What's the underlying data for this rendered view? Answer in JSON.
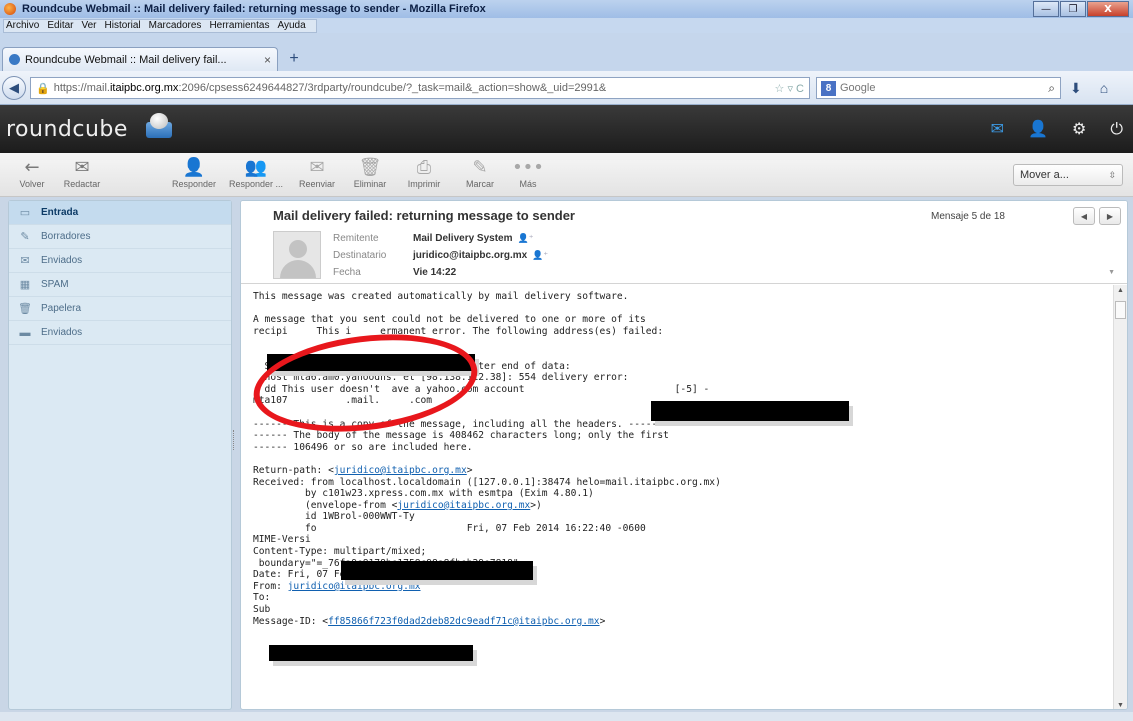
{
  "window": {
    "title": "Roundcube Webmail :: Mail delivery failed: returning message to sender - Mozilla Firefox",
    "minimize": "—",
    "maximize": "❐",
    "close": "X"
  },
  "menubar": {
    "items": [
      "Archivo",
      "Editar",
      "Ver",
      "Historial",
      "Marcadores",
      "Herramientas",
      "Ayuda"
    ]
  },
  "tab": {
    "label": "Roundcube Webmail :: Mail delivery fail...",
    "close": "×",
    "new_tab": "+"
  },
  "navbar": {
    "url_prefix": "https://mail.",
    "url_domain": "itaipbc.org.mx",
    "url_rest": ":2096/cpsess6249644827/3rdparty/roundcube/?_task=mail&_action=show&_uid=2991&",
    "search_placeholder": "Google",
    "search_engine_letter": "8"
  },
  "app": {
    "logo": "roundcube",
    "icons": [
      "mail-icon",
      "user-icon",
      "gear-icon",
      "power-icon"
    ]
  },
  "toolbar": {
    "buttons": [
      {
        "label": "Volver",
        "icon": "←"
      },
      {
        "label": "Redactar",
        "icon": "✉"
      },
      {
        "label": "Responder",
        "icon": "👤"
      },
      {
        "label": "Responder ...",
        "icon": "👥"
      },
      {
        "label": "Reenviar",
        "icon": "✉"
      },
      {
        "label": "Eliminar",
        "icon": "🗑"
      },
      {
        "label": "Imprimir",
        "icon": "⎙"
      },
      {
        "label": "Marcar",
        "icon": "✎"
      },
      {
        "label": "Más",
        "icon": "•••"
      }
    ],
    "move_select": "Mover a..."
  },
  "folders": [
    {
      "label": "Entrada",
      "icon": "▭",
      "selected": true
    },
    {
      "label": "Borradores",
      "icon": "✎",
      "selected": false
    },
    {
      "label": "Enviados",
      "icon": "✉",
      "selected": false
    },
    {
      "label": "SPAM",
      "icon": "▦",
      "selected": false
    },
    {
      "label": "Papelera",
      "icon": "🗑",
      "selected": false
    },
    {
      "label": "Enviados",
      "icon": "▬",
      "selected": false
    }
  ],
  "message": {
    "subject": "Mail delivery failed: returning message to sender",
    "counter": "Mensaje 5 de 18",
    "prev": "◀",
    "next": "▶",
    "headers": {
      "from_label": "Remitente",
      "from_value": "Mail Delivery System",
      "to_label": "Destinatario",
      "to_value": "juridico@itaipbc.org.mx",
      "date_label": "Fecha",
      "date_value": "Vie 14:22"
    },
    "lines": [
      "This message was created automatically by mail delivery software.",
      "",
      "A message that you sent could not be delivered to one or more of its",
      "recipi     This i     ermanent error. The following address(es) failed:",
      "",
      "",
      "  SMTP error from remote m il server after end of data:",
      "  host mta6.am0.yahoodns. et [98.138.112.38]: 554 delivery error:",
      "  dd This user doesn't  ave a yahoo.com account                          [-5] -",
      "mta107          .mail.     .com",
      "",
      "------ This is a copy of the message, including all the headers. ------",
      "------ The body of the message is 408462 characters long; only the first",
      "------ 106496 or so are included here.",
      "",
      "Return-path: <juridico@itaipbc.org.mx>",
      "Received: from localhost.localdomain ([127.0.0.1]:38474 helo=mail.itaipbc.org.mx)",
      "         by c101w23.xpress.com.mx with esmtpa (Exim 4.80.1)",
      "         (envelope-from <juridico@itaipbc.org.mx>)",
      "         id 1WBrol-000WWT-Ty",
      "         fo                          Fri, 07 Feb 2014 16:22:40 -0600",
      "MIME-Versi",
      "Content-Type: multipart/mixed;",
      " boundary=\"=_76fa9e8178be1758c98a8fbeb29e7818\"",
      "Date: Fri, 07 Feb 2014 14:22:39 -0800",
      "From: juridico@itaipbc.org.mx",
      "To:",
      "Sub",
      "Message-ID: <ff85866f723f0dad2deb82dc9eadf71c@itaipbc.org.mx>"
    ]
  }
}
